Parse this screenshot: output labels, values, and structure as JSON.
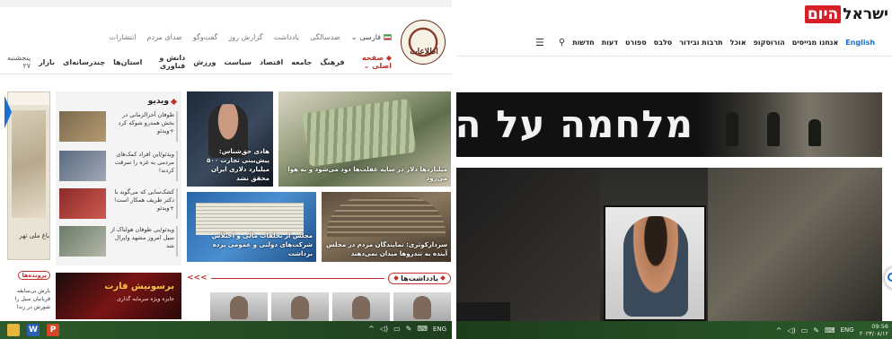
{
  "left_site": {
    "logo_text": "اطلاعات",
    "lang_label": "فارسی",
    "top_nav": [
      "صدسالگی",
      "یادداشت",
      "گزارش روز",
      "گفت‌وگو",
      "صدای مردم",
      "انتشارات"
    ],
    "main_nav": [
      "صفحه اصلی",
      "فرهنگ",
      "جامعه",
      "اقتصاد",
      "سیاست",
      "ورزش",
      "دانش و فناوری",
      "استان‌ها",
      "چندرسانه‌ای",
      "بازار"
    ],
    "date": "پنجشنبه ۲۷",
    "video_section_title": "ویدیو",
    "video_items": [
      "طوفان آخرالزمانی در بخش همدرو شوکه کرد +ویدئو",
      "ویدئو/این افراد کمک‌های مردمی به غزه را سرقت کردند!",
      "کشک‌سابی که می‌گوید با دکتر ظریف همکار است! +ویدئو",
      "ویدئو/بی طوفان هولناک از سیل امروز مشهد واپرال شد"
    ],
    "feature_captions": [
      "هادی حق‌شناس: پیش‌بینی تجارت ۵۰۰ میلیارد دلاری ایران محقق نشد",
      "میلیاردها دلار در سایه غفلت‌ها دود می‌شود و به هوا می‌رود",
      "مجلس از تخلفات مالی و اختلاس شرکت‌های دولتی و عمومی پرده برداشت",
      "سردارکوثری: نمایندگان مردم در مجلس آینده به تندروها میدان نمی‌دهند"
    ],
    "notes_label": "یادداشت‌ها",
    "notes_arrows": "<<<",
    "strip_caption": "باغ ملی تهر",
    "bottom_tag": "پرونده‌ها",
    "bottom_texts": [
      "بارش بی‌سابقه قربانیان سیل را",
      "شورش در زندا"
    ],
    "ad_title": "برسونیش فارت",
    "ad_sub": "جایزه ویژه سرمایه گذاری"
  },
  "left_taskbar": {
    "word_glyph": "W",
    "ppt_glyph": "P",
    "tray_text": "ENG"
  },
  "right_site": {
    "brand_part1": "ישראל",
    "brand_part2": "היום",
    "nav_items": [
      "חדשות",
      "דעות",
      "ספורט",
      "סלבס",
      "תרבות ובידור",
      "אוכל",
      "הורוסקופ",
      "אנחנו מגייסים",
      "English"
    ],
    "banner_text": "מלחמה על הבית"
  },
  "right_taskbar": {
    "tray_text": "ENG",
    "clock_time": "09:56",
    "clock_date": "۲۰۲۳/۰۸/۱۲"
  },
  "colors": {
    "accent_red": "#c0302c",
    "brand_red": "#d62027",
    "link_blue": "#1a6fd1",
    "taskbar_green": "#2c5a2a"
  }
}
